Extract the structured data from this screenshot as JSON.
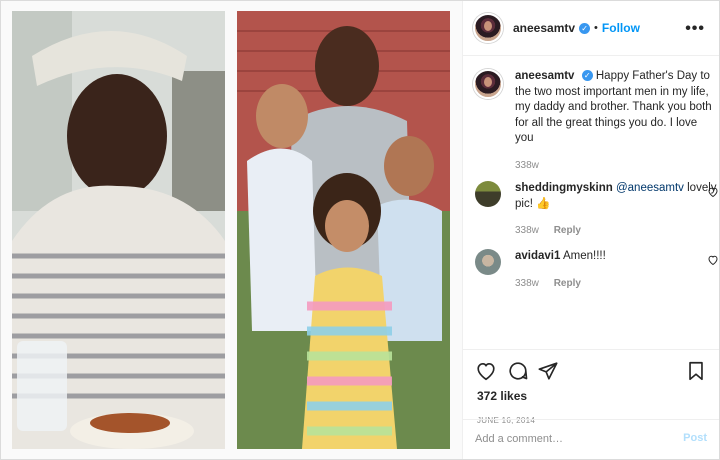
{
  "post": {
    "username": "aneesamtv",
    "follow_label": "Follow",
    "more_label": "•••",
    "caption": {
      "username": "aneesamtv",
      "text": "Happy Father's Day to the two most important men in my life, my daddy and brother. Thank you both for all the great things you do. I love you",
      "age": "338w"
    },
    "comments": [
      {
        "username": "sheddingmyskinn",
        "mention": "@aneesamtv",
        "text": "lovely pic! 👍",
        "age": "338w",
        "reply_label": "Reply"
      },
      {
        "username": "avidavi1",
        "text": "Amen!!!!",
        "age": "338w",
        "reply_label": "Reply"
      }
    ],
    "likes": "372 likes",
    "date": "JUNE 16, 2014",
    "add_comment_placeholder": "Add a comment…",
    "post_label": "Post"
  },
  "colors": {
    "link": "#0095f6",
    "verified": "#3897f0",
    "muted": "#8e8e8e",
    "post_disabled": "#b2dffc"
  }
}
